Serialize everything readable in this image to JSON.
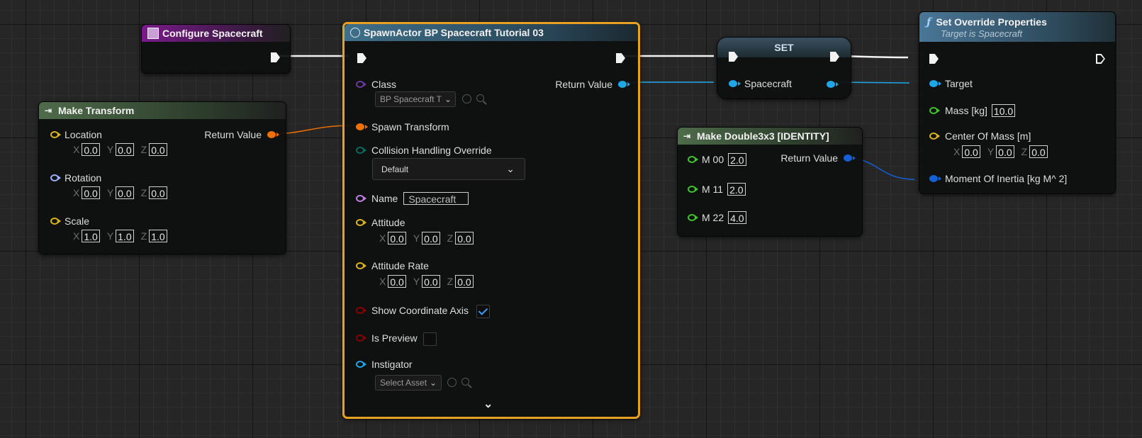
{
  "configure": {
    "title": "Configure Spacecraft"
  },
  "make_transform": {
    "title": "Make Transform",
    "return_label": "Return Value",
    "location": {
      "label": "Location",
      "x": "0.0",
      "y": "0.0",
      "z": "0.0"
    },
    "rotation": {
      "label": "Rotation",
      "x": "0.0",
      "y": "0.0",
      "z": "0.0"
    },
    "scale": {
      "label": "Scale",
      "x": "1.0",
      "y": "1.0",
      "z": "1.0"
    }
  },
  "spawn": {
    "title": "SpawnActor BP Spacecraft Tutorial 03",
    "class_label": "Class",
    "class_value": "BP Spacecraft T",
    "return_label": "Return Value",
    "spawn_transform": "Spawn Transform",
    "collision_label": "Collision Handling Override",
    "collision_value": "Default",
    "name_label": "Name",
    "name_value": "Spacecraft",
    "attitude": {
      "label": "Attitude",
      "x": "0.0",
      "y": "0.0",
      "z": "0.0"
    },
    "attitude_rate": {
      "label": "Attitude Rate",
      "x": "0.0",
      "y": "0.0",
      "z": "0.0"
    },
    "show_axis_label": "Show Coordinate Axis",
    "show_axis_checked": true,
    "is_preview_label": "Is Preview",
    "is_preview_checked": false,
    "instigator_label": "Instigator",
    "instigator_value": "Select Asset"
  },
  "set_node": {
    "title": "SET",
    "var_label": "Spacecraft"
  },
  "make_double": {
    "title": "Make Double3x3 [IDENTITY]",
    "return_label": "Return Value",
    "rows": [
      {
        "label": "M 00",
        "value": "2.0"
      },
      {
        "label": "M 11",
        "value": "2.0"
      },
      {
        "label": "M 22",
        "value": "4.0"
      }
    ]
  },
  "set_override": {
    "title": "Set Override Properties",
    "subtitle": "Target is Spacecraft",
    "target_label": "Target",
    "mass_label": "Mass [kg]",
    "mass_value": "10.0",
    "com_label": "Center Of Mass [m]",
    "com": {
      "x": "0.0",
      "y": "0.0",
      "z": "0.0"
    },
    "moi_label": "Moment Of Inertia [kg M^ 2]"
  },
  "axis": {
    "x": "X",
    "y": "Y",
    "z": "Z"
  },
  "colors": {
    "exec": "#f2f2f2",
    "struct_orange": "#f07000",
    "object_blue": "#1fa7e8",
    "matrix_blue": "#1560d6",
    "vector_yellow": "#d8b420",
    "rotator_lilac": "#9ab0ff",
    "float_green": "#3fc430",
    "bool_red": "#8a0000",
    "selection": "#e8a020"
  }
}
